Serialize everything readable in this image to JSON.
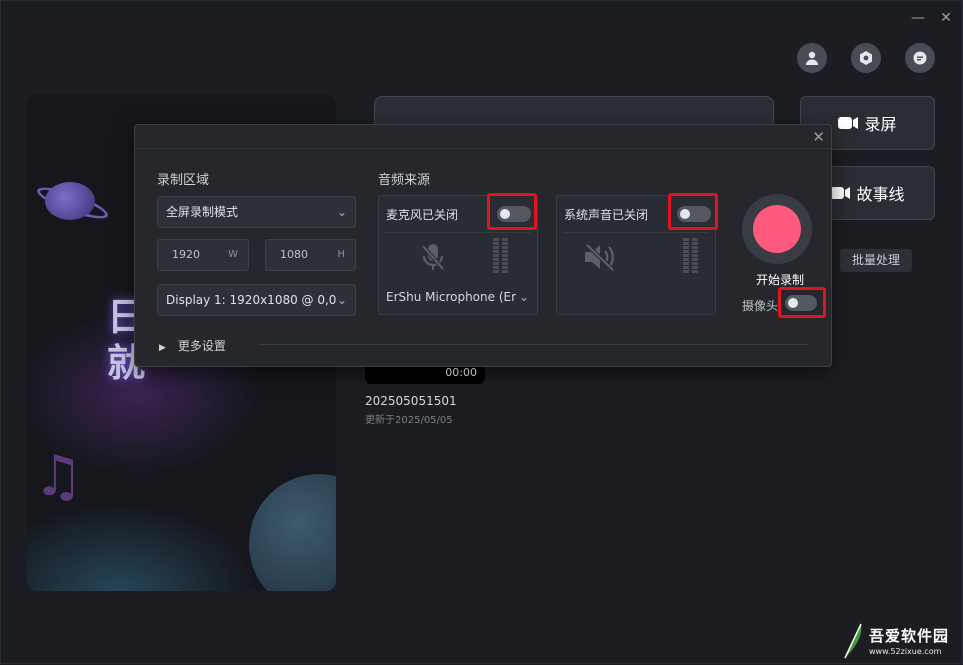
{
  "window": {
    "minimize_glyph": "—",
    "close_glyph": "✕"
  },
  "banner": {
    "line1": "日",
    "line2": "就"
  },
  "top_icons": [
    "user-icon",
    "settings-hex-icon",
    "message-icon"
  ],
  "side_buttons": {
    "record_screen": "录屏",
    "storyline": "故事线",
    "batch": "批量处理"
  },
  "recording": {
    "duration": "00:00",
    "name": "202505051501",
    "updated": "更新于2025/05/05"
  },
  "popup": {
    "close_glyph": "✕",
    "area_label": "录制区域",
    "mode_value": "全屏录制模式",
    "width_value": "1920",
    "width_unit": "W",
    "height_value": "1080",
    "height_unit": "H",
    "display_value": "Display 1: 1920x1080 @ 0,0",
    "audio_label": "音频来源",
    "mic_title": "麦克风已关闭",
    "mic_device": "ErShu Microphone (Er",
    "system_title": "系统声音已关闭",
    "start_record": "开始录制",
    "camera_label": "摄像头",
    "more_settings": "更多设置"
  },
  "watermark": {
    "text": "吾爱软件园",
    "url": "www.52zixue.com"
  },
  "colors": {
    "record_accent": "#ff5a7e",
    "highlight": "#e0141e",
    "background": "#1c1d22"
  }
}
